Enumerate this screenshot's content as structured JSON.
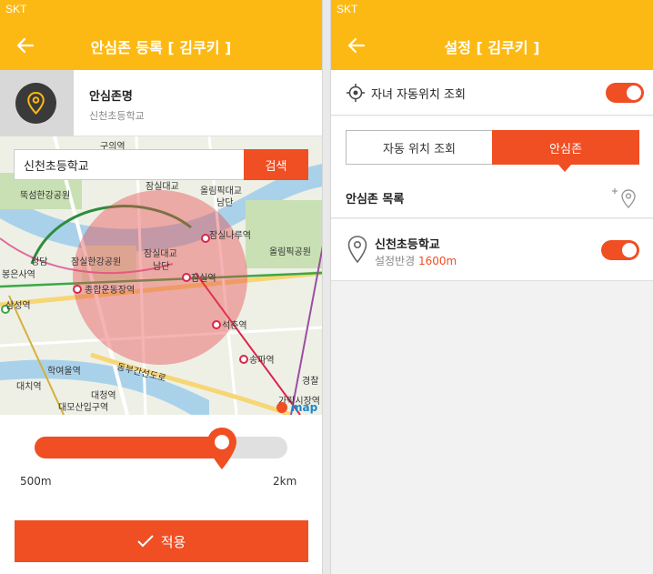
{
  "left_screen": {
    "carrier": "SKT",
    "title": "안심존 등록 [ 김쿠키 ]",
    "zone_name_label": "안심존명",
    "zone_name_value": "신천초등학교",
    "search": {
      "value": "신천초등학교",
      "button": "검색"
    },
    "map": {
      "labels": [
        "뚝섬한강공원",
        "잠실대교",
        "올림픽대교",
        "남단",
        "잠실나루역",
        "잠실한강공원",
        "잠실대교",
        "남단",
        "올림픽공원",
        "봉은사역",
        "청담",
        "종합운동장역",
        "잠실역",
        "삼성역",
        "석촌역",
        "송파역",
        "학여울역",
        "대치역",
        "대청역",
        "대모산입구역",
        "동부간선도로",
        "경찰",
        "가락시장역",
        "구의역"
      ],
      "brand": "map"
    },
    "slider": {
      "min_label": "500m",
      "max_label": "2km",
      "value_fraction": 0.74
    },
    "apply_button": "적용"
  },
  "right_screen": {
    "carrier": "SKT",
    "title": "설정 [ 김쿠키 ]",
    "auto_location_label": "자녀 자동위치 조회",
    "auto_location_on": true,
    "tabs": [
      {
        "label": "자동 위치 조회",
        "active": false
      },
      {
        "label": "안심존",
        "active": true
      }
    ],
    "list_title": "안심존 목록",
    "items": [
      {
        "name": "신천초등학교",
        "radius_label": "설정반경",
        "radius_value": "1600m",
        "enabled": true
      }
    ]
  },
  "colors": {
    "header": "#fdb913",
    "accent": "#f04e23"
  },
  "icons": [
    "back-arrow-icon",
    "location-pin-icon",
    "crosshair-icon",
    "add-location-icon",
    "check-icon"
  ]
}
